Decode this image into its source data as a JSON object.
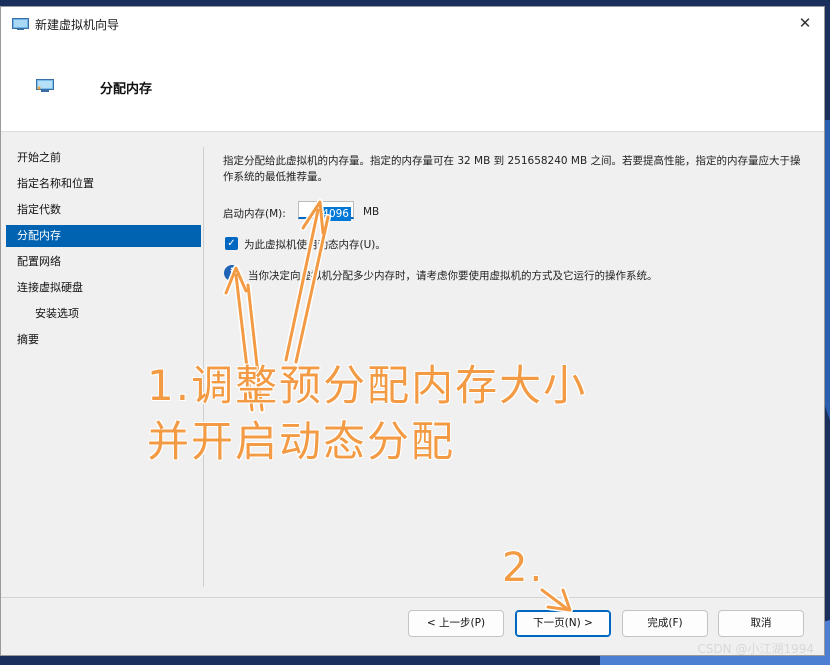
{
  "window": {
    "title": "新建虚拟机向导",
    "close_glyph": "✕"
  },
  "header": {
    "title": "分配内存"
  },
  "sidebar": {
    "items": [
      {
        "label": "开始之前"
      },
      {
        "label": "指定名称和位置"
      },
      {
        "label": "指定代数"
      },
      {
        "label": "分配内存"
      },
      {
        "label": "配置网络"
      },
      {
        "label": "连接虚拟硬盘"
      },
      {
        "label": "安装选项"
      },
      {
        "label": "摘要"
      }
    ],
    "active_item": "分配内存"
  },
  "content": {
    "description": "指定分配给此虚拟机的内存量。指定的内存量可在 32 MB 到 251658240 MB 之间。若要提高性能，指定的内存量应大于操作系统的最低推荐量。",
    "startup_memory_label": "启动内存(M):",
    "startup_memory_value": "4096",
    "memory_unit": "MB",
    "dynamic_memory_label": "为此虚拟机使用动态内存(U)。",
    "dynamic_memory_checked": true,
    "info_glyph": "i",
    "info_text": "当你决定向虚拟机分配多少内存时，请考虑你要使用虚拟机的方式及它运行的操作系统。"
  },
  "buttons": {
    "back": "< 上一步(P)",
    "next": "下一页(N) >",
    "finish": "完成(F)",
    "cancel": "取消"
  },
  "annotations": {
    "step1_line1": "1.调整预分配内存大小",
    "step1_line2": "并开启动态分配",
    "step2": "2.",
    "color": "#f39a44"
  },
  "watermark": "CSDN @小江湖1994",
  "colors": {
    "accent": "#0063b1",
    "annotation": "#f39a44"
  }
}
